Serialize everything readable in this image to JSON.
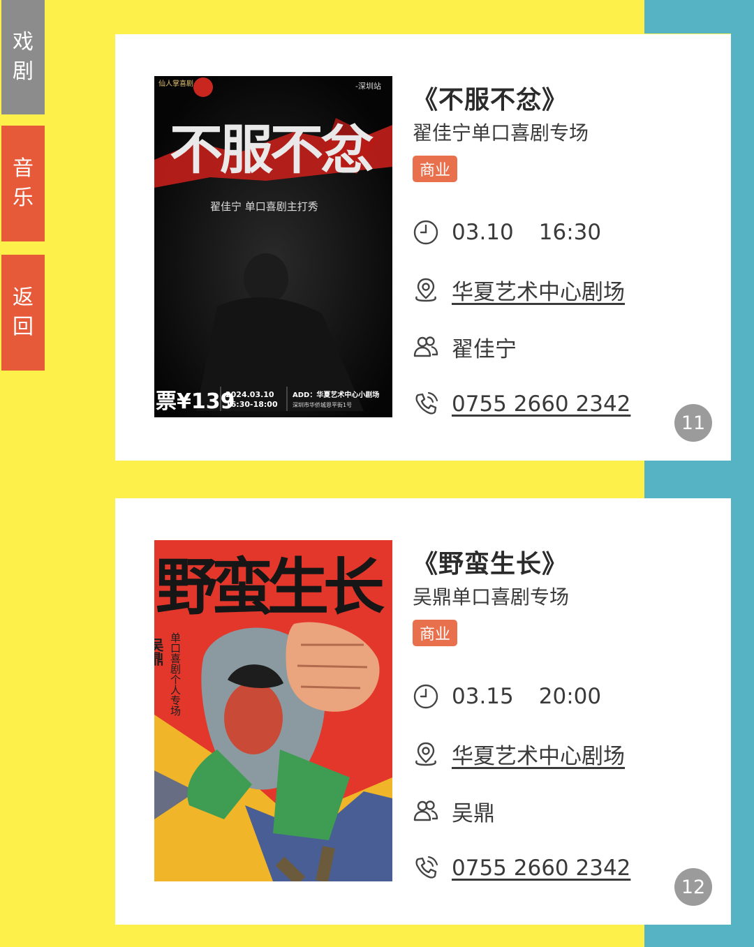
{
  "side_tabs": [
    {
      "label_top": "戏",
      "label_bottom": "剧"
    },
    {
      "label_top": "音",
      "label_bottom": "乐"
    },
    {
      "label_top": "返",
      "label_bottom": "回"
    }
  ],
  "events": [
    {
      "title": "《不服不忿》",
      "subtitle": "翟佳宁单口喜剧专场",
      "tag": "商业",
      "date": "03.10",
      "time": "16:30",
      "venue": "华夏艺术中心剧场",
      "performer": "翟佳宁",
      "phone": "0755 2660 2342",
      "page": "11",
      "poster": {
        "corner_left": "仙人掌喜剧",
        "corner_right": "-深圳站",
        "big_title": "不服不忿",
        "line": "翟佳宁 单口喜剧主打秀",
        "price": "票¥139",
        "date_line1": "2024.03.10",
        "date_line2": "16:30-18:00",
        "add_line": "ADD：华夏艺术中心小剧场",
        "add_line2": "深圳市华侨城恩平街1号"
      }
    },
    {
      "title": "《野蛮生长》",
      "subtitle": "吴鼎单口喜剧专场",
      "tag": "商业",
      "date": "03.15",
      "time": "20:00",
      "venue": "华夏艺术中心剧场",
      "performer": "吴鼎",
      "phone": "0755 2660 2342",
      "page": "12",
      "poster": {
        "big_title": "野蛮生长",
        "name_vertical": "吴鼎",
        "line_vertical": "单口喜剧个人专场"
      }
    }
  ],
  "icons": [
    "clock-icon",
    "location-pin-icon",
    "people-icon",
    "phone-icon"
  ],
  "colors": {
    "background": "#fdf04a",
    "teal": "#55b3c3",
    "tab_active": "#8c8c8c",
    "tab": "#e65a3a",
    "tag": "#e8704d",
    "badge": "#9b9b9b"
  }
}
